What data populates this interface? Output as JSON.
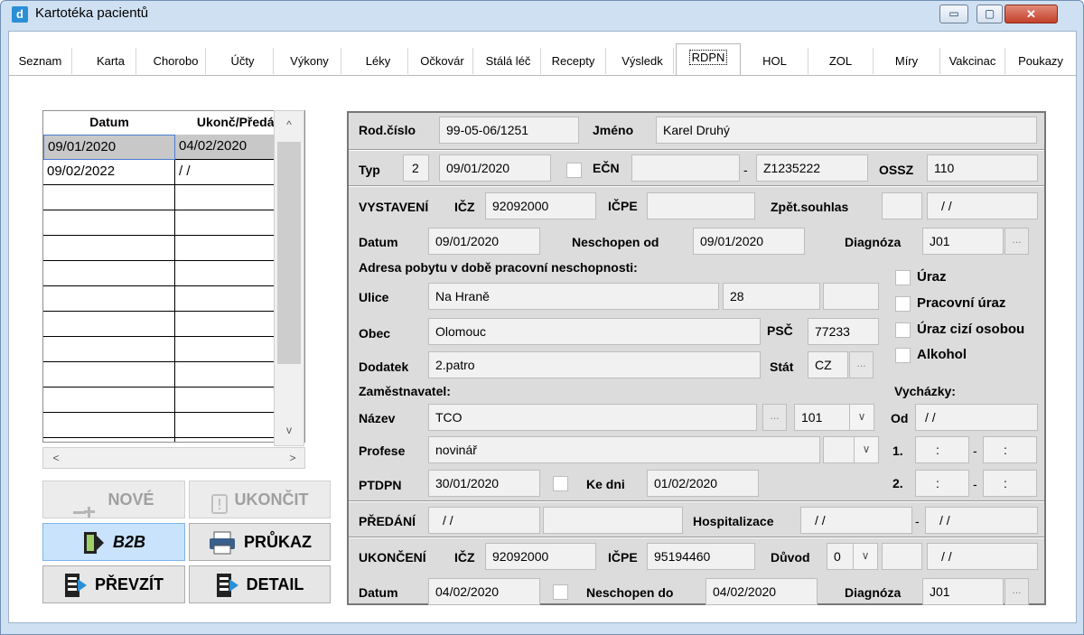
{
  "window": {
    "title": "Kartotéka pacientů",
    "minimize": "▭",
    "maximize": "▢",
    "close": "✕"
  },
  "tabs": [
    "Seznam",
    "Karta",
    "Chorobo",
    "Účty",
    "Výkony",
    "Léky",
    "Očkovár",
    "Stálá léč",
    "Recepty",
    "Výsledk",
    "RDPN",
    "HOL",
    "ZOL",
    "Míry",
    "Vakcinac",
    "Poukazy"
  ],
  "active_tab": "RDPN",
  "grid": {
    "headers": [
      "Datum",
      "Ukonč/Předán"
    ],
    "rows": [
      [
        "09/01/2020",
        "04/02/2020"
      ],
      [
        "09/02/2022",
        "/ /"
      ]
    ],
    "scroll_left": "<",
    "scroll_right": ">",
    "scroll_up": "^",
    "scroll_down": "v"
  },
  "buttons": {
    "nove": "NOVÉ",
    "ukoncit": "UKONČIT",
    "b2b": "B2B",
    "prukaz": "PRŮKAZ",
    "prevzit": "PŘEVZÍT",
    "detail": "DETAIL"
  },
  "form": {
    "rodcislo_label": "Rod.číslo",
    "rodcislo": "99-05-06/1251",
    "jmeno_label": "Jméno",
    "jmeno": "Karel Druhý",
    "typ_label": "Typ",
    "typ": "2",
    "typ_date": "09/01/2020",
    "ecn_label": "EČN",
    "ecn": "",
    "ecn_dash": "-",
    "ecn2": "Z1235222",
    "ossz_label": "OSSZ",
    "ossz": "110",
    "vystaveni_label": "VYSTAVENÍ",
    "icz_label": "IČZ",
    "icz": "92092000",
    "icpe_label": "IČPE",
    "icpe": "",
    "zpet_label": "Zpět.souhlas",
    "zpet": "",
    "zpet_date": "/ /",
    "datum_label": "Datum",
    "datum": "09/01/2020",
    "neschopen_od_label": "Neschopen od",
    "neschopen_od": "09/01/2020",
    "diagnoza_label": "Diagnóza",
    "diagnoza": "J01",
    "dots": "...",
    "adresa_heading": "Adresa pobytu v době pracovní neschopnosti:",
    "ulice_label": "Ulice",
    "ulice": "Na Hraně",
    "cislo": "28",
    "cislo2": "",
    "obec_label": "Obec",
    "obec": "Olomouc",
    "psc_label": "PSČ",
    "psc": "77233",
    "dodatek_label": "Dodatek",
    "dodatek": "2.patro",
    "stat_label": "Stát",
    "stat": "CZ",
    "uraz": "Úraz",
    "pracovni_uraz": "Pracovní úraz",
    "uraz_cizi": "Úraz cizí osobou",
    "alkohol": "Alkohol",
    "vychazky_label": "Vycházky:",
    "zamestnavatel_heading": "Zaměstnavatel:",
    "nazev_label": "Název",
    "nazev": "TCO",
    "nazev_code": "101",
    "od_label": "Od",
    "od": "/ /",
    "profese_label": "Profese",
    "profese": "novinář",
    "v1_label": "1.",
    "v1a": ":",
    "v1b": ":",
    "v2_label": "2.",
    "v2a": ":",
    "v2b": ":",
    "ptdpn_label": "PTDPN",
    "ptdpn": "30/01/2020",
    "ke_dni_label": "Ke dni",
    "ke_dni": "01/02/2020",
    "predani_label": "PŘEDÁNÍ",
    "predani": "/ /",
    "predani2": "",
    "hosp_label": "Hospitalizace",
    "hosp1": "/ /",
    "hosp2": "/ /",
    "ukonceni_label": "UKONČENÍ",
    "u_icz": "92092000",
    "u_icpe": "95194460",
    "duvod_label": "Důvod",
    "duvod": "0",
    "duvod2": "",
    "duvod_date": "/ /",
    "u_datum": "04/02/2020",
    "neschopen_do_label": "Neschopen do",
    "neschopen_do": "04/02/2020",
    "u_diagnoza": "J01",
    "dash": "-",
    "dd": "∨"
  }
}
